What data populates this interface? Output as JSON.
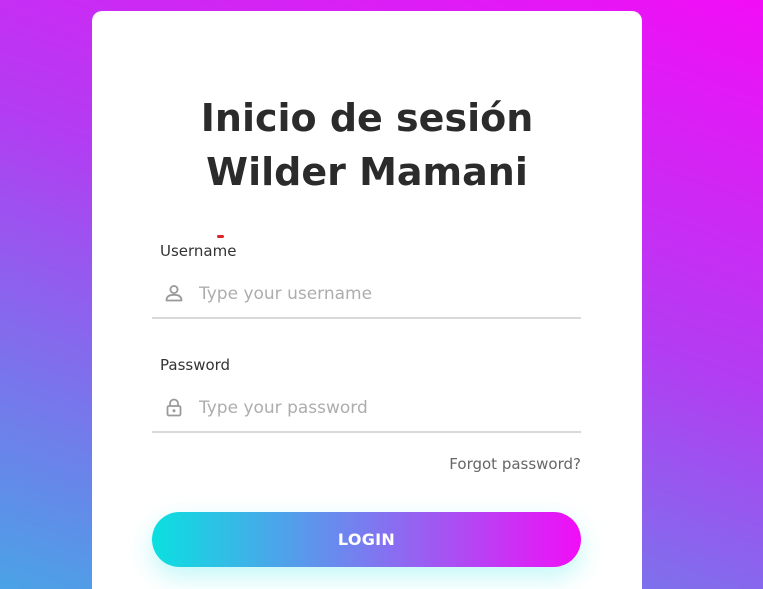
{
  "login_card": {
    "title_line1": "Inicio de sesión",
    "title_line2": "Wilder Mamani",
    "username": {
      "label": "Username",
      "placeholder": "Type your username",
      "value": "",
      "icon": "user-icon"
    },
    "password": {
      "label": "Password",
      "placeholder": "Type your password",
      "value": "",
      "icon": "lock-icon"
    },
    "forgot_label": "Forgot password?",
    "login_label": "LOGIN"
  },
  "colors": {
    "background_start": "#f20df7",
    "background_end": "#4aa3e6",
    "button_start": "#0ae0e0",
    "button_end": "#f20df7",
    "title": "#2b2b2b"
  }
}
